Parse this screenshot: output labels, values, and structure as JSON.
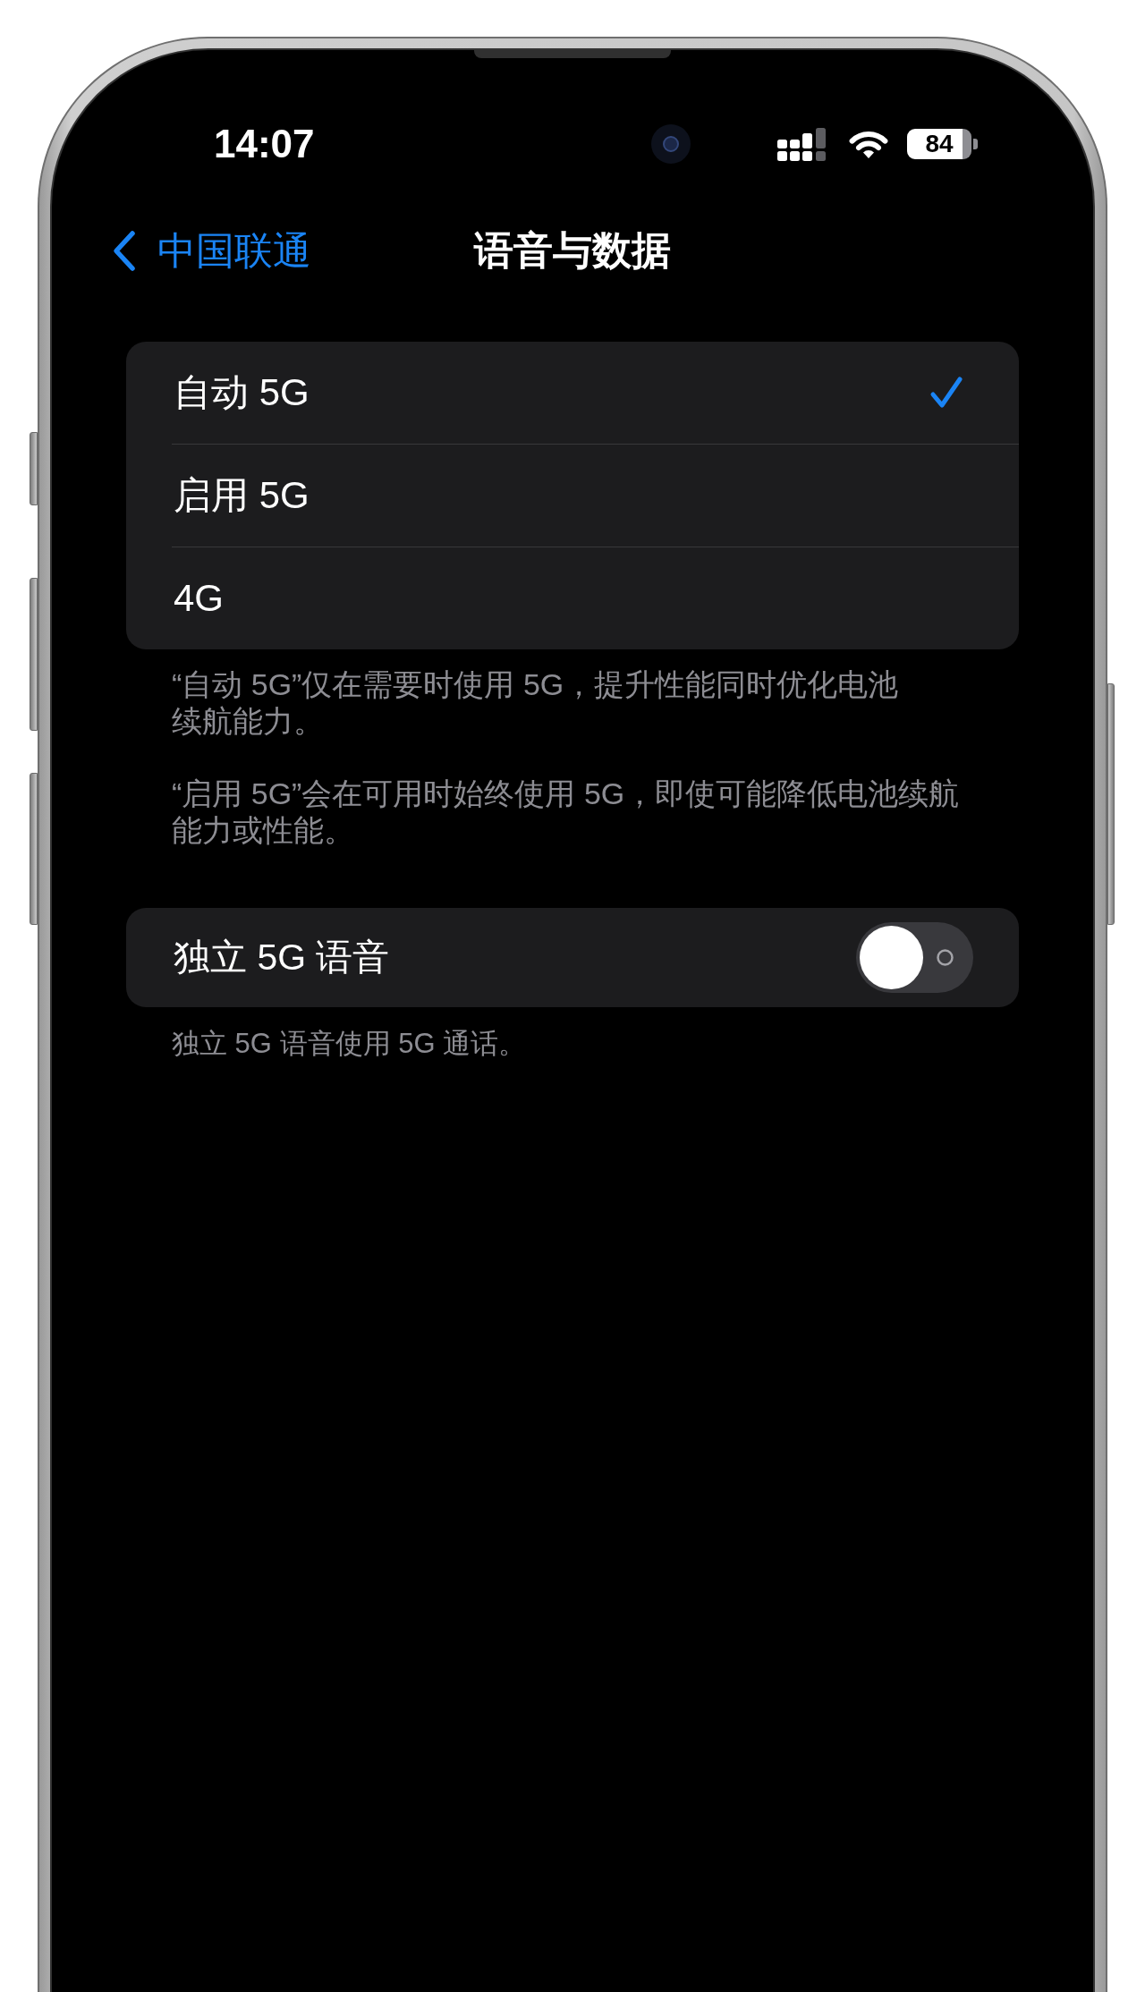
{
  "status_bar": {
    "time": "14:07",
    "battery": "84"
  },
  "nav": {
    "back": "中国联通",
    "title": "语音与数据"
  },
  "network_options": [
    {
      "label": "自动 5G",
      "selected": true
    },
    {
      "label": "启用 5G",
      "selected": false
    },
    {
      "label": "4G",
      "selected": false
    }
  ],
  "network_notes": [
    {
      "lines": [
        "“自动 5G”仅在需要时使用 5G，提升性能同时优化电池",
        "续航能力。"
      ]
    },
    {
      "lines": [
        "“启用 5G”会在可用时始终使用 5G，即使可能降低电池续航",
        "能力或性能。"
      ]
    }
  ],
  "standalone_voice": {
    "label": "独立 5G 语音",
    "on": false
  },
  "standalone_note": "独立 5G 语音使用 5G 通话。"
}
